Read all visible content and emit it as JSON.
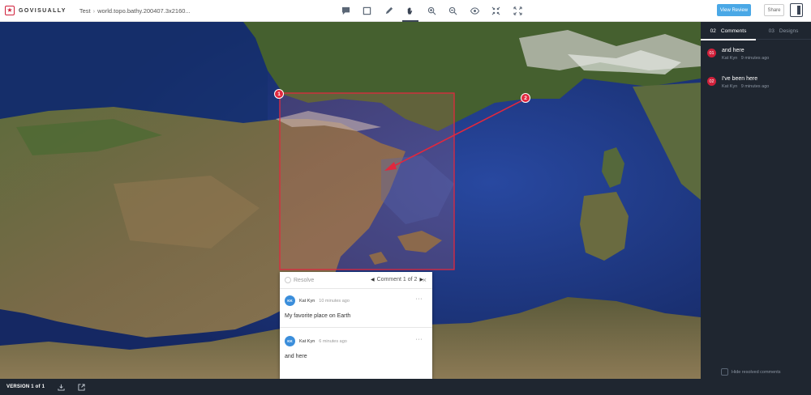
{
  "app": {
    "logo_text": "GOVISUALLY",
    "breadcrumb": [
      "Test",
      "world.topo.bathy.200407.3x2160..."
    ]
  },
  "toolbar": {
    "tools": [
      "comment-tool",
      "rectangle-tool",
      "pen-tool",
      "pan-tool",
      "zoom-in-tool",
      "zoom-out-tool",
      "preview-tool",
      "fit-tool",
      "fullscreen-tool"
    ],
    "active_tool": "pan-tool",
    "view_review_label": "View Review",
    "share_label": "Share"
  },
  "panel": {
    "tabs": [
      {
        "count": "02",
        "label": "Comments",
        "active": true
      },
      {
        "count": "03",
        "label": "Designs",
        "active": false
      }
    ],
    "comments": [
      {
        "num": "01",
        "text": "and here",
        "author": "Kat Kyn",
        "time": "9 minutes ago"
      },
      {
        "num": "02",
        "text": "I've been here",
        "author": "Kat Kyn",
        "time": "9 minutes ago"
      }
    ],
    "hide_resolved_label": "Hide resolved comments"
  },
  "footer": {
    "version_label": "VERSION 1 of 1"
  },
  "markers": [
    {
      "num": "1"
    },
    {
      "num": "2"
    }
  ],
  "popup": {
    "resolve_label": "Resolve",
    "nav_label": "Comment 1 of 2",
    "close_glyph": "×",
    "prev_glyph": "◀",
    "next_glyph": "▶",
    "menu_glyph": "···",
    "thread": [
      {
        "initials": "KK",
        "author": "Kat Kyn",
        "time": "10 minutes ago",
        "text": "My favorite place on Earth"
      },
      {
        "initials": "KK",
        "author": "Kat Kyn",
        "time": "6 minutes ago",
        "text": "and here"
      }
    ]
  },
  "colors": {
    "accent_red": "#d0203a",
    "button_blue": "#4aa8e6",
    "panel_bg": "#1f2630",
    "avatar_blue": "#3b8edb"
  }
}
